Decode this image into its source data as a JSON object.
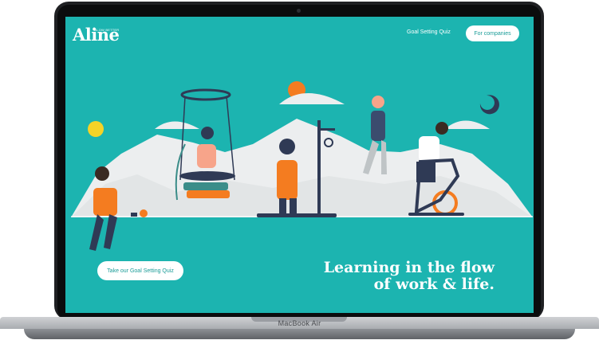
{
  "device": {
    "model_label": "MacBook Air"
  },
  "brand": {
    "logo_text": "Aline",
    "logo_tagline": "GLOW BETTER",
    "primary_color": "#1cb4b0",
    "accent_color": "#f47c20"
  },
  "nav": {
    "quiz_link": "Goal Setting Quiz",
    "companies_button": "For companies"
  },
  "hero": {
    "headline_line1": "Learning in the flow",
    "headline_line2": "of work & life.",
    "cta_button": "Take our Goal Setting Quiz"
  },
  "icons": [
    "sun-icon",
    "moon-icon",
    "logo-mark"
  ]
}
